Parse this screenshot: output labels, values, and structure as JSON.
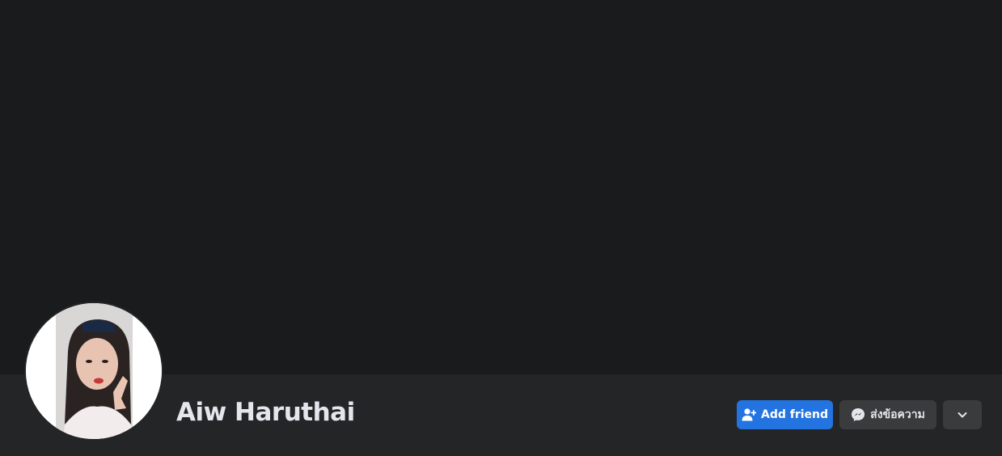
{
  "profile": {
    "name": "Aiw Haruthai",
    "avatar_icon": "profile-photo"
  },
  "actions": {
    "add_friend_label": "Add friend",
    "add_friend_icon": "person-add-icon",
    "message_label": "ส่งข้อความ",
    "message_icon": "messenger-icon",
    "more_icon": "chevron-down-icon"
  },
  "colors": {
    "cover": "#1a1b1d",
    "bar": "#242526",
    "primary": "#2374e1",
    "secondary": "#3a3b3c",
    "text": "#e4e6eb"
  }
}
